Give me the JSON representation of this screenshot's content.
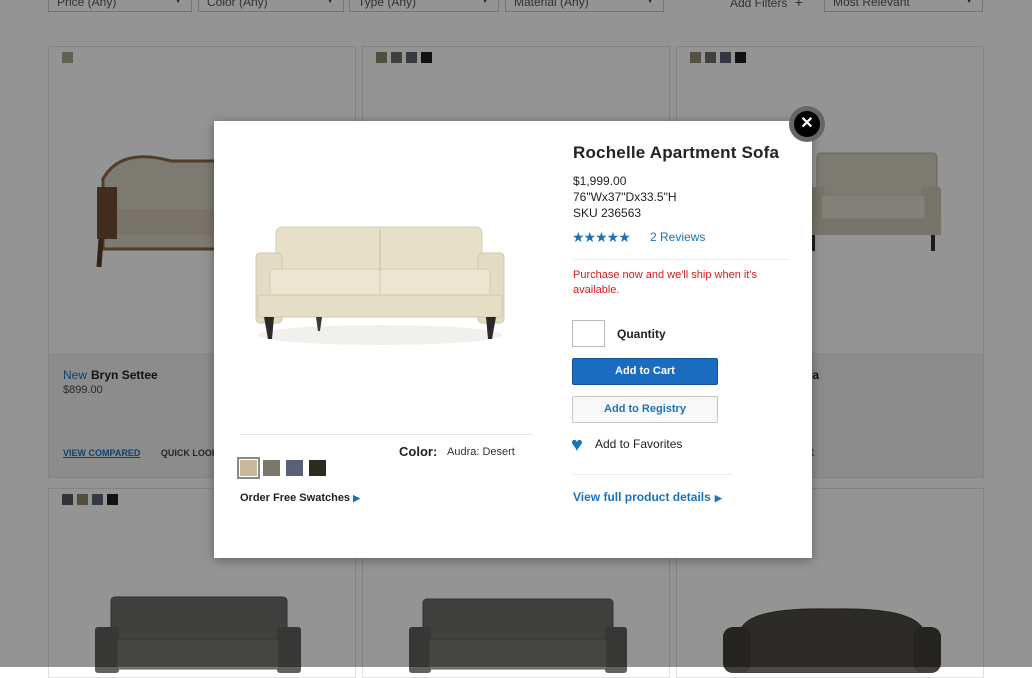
{
  "filters": [
    {
      "label": "Price (Any)"
    },
    {
      "label": "Color (Any)"
    },
    {
      "label": "Type (Any)"
    },
    {
      "label": "Material (Any)"
    }
  ],
  "add_filters_label": "Add Filters",
  "sort_label": "Most Relevant",
  "cards": [
    {
      "badge": "New",
      "name": "Bryn Settee",
      "price": "$899.00",
      "view_compared": "VIEW COMPARED",
      "quick_look": "QUICK LOOK",
      "swatches": [
        "#a7a78f"
      ]
    },
    {
      "swatches": [
        "#8c8a6e",
        "#6e6e6a",
        "#5c6272",
        "#1f1f1f"
      ]
    },
    {
      "name_partial": "ofa",
      "quick_look_partial": "OK",
      "swatches": [
        "#8f8a78",
        "#6e6e6a",
        "#586070",
        "#1f1f1f"
      ]
    },
    {
      "swatches": [
        "#555b5c",
        "#8c8a6e",
        "#5c6272",
        "#1f1f1f"
      ]
    },
    {
      "swatches": []
    },
    {
      "swatches": []
    }
  ],
  "modal": {
    "close_glyph": "✕",
    "product_title": "Rochelle Apartment Sofa",
    "price": "$1,999.00",
    "dimensions": "76\"Wx37\"Dx33.5\"H",
    "sku": "SKU 236563",
    "rating_stars": "★★★★★",
    "reviews_link": "2 Reviews",
    "notice": "Purchase now and we'll ship when it's available.",
    "quantity_value": "",
    "quantity_label": "Quantity",
    "add_to_cart": "Add to Cart",
    "add_to_registry": "Add to Registry",
    "add_to_favorites": "Add to Favorites",
    "view_full_details": "View full product details",
    "color_label": "Color:",
    "color_value": "Audra: Desert",
    "order_swatches": "Order Free Swatches",
    "swatches": [
      "#c8b89a",
      "#7a786a",
      "#5a6076",
      "#2e2a20"
    ],
    "selected_swatch": 0
  },
  "colors": {
    "accent": "#1a73b8",
    "button": "#1a6cc0",
    "notice": "#d01c1c"
  },
  "icons": [
    "close-icon",
    "chevron-down-icon",
    "plus-icon",
    "star-icon",
    "heart-icon",
    "chevron-right-icon"
  ]
}
